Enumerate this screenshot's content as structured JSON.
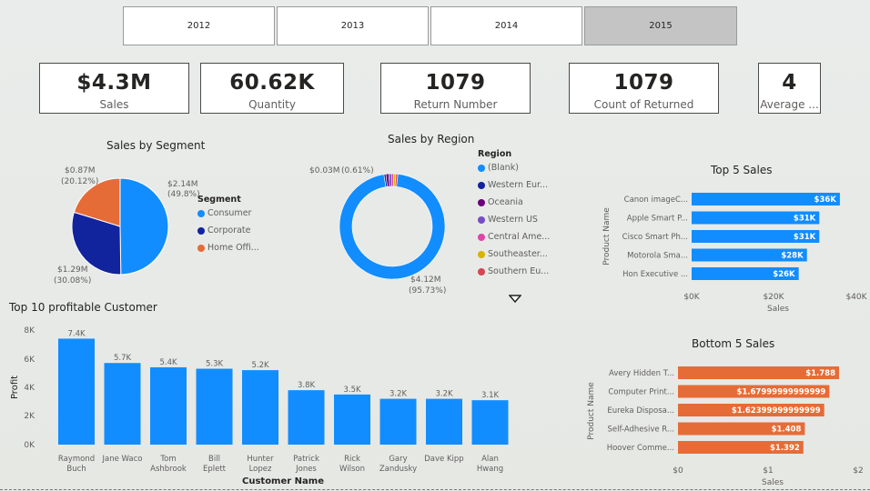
{
  "slicer": {
    "years": [
      "2012",
      "2013",
      "2014",
      "2015"
    ],
    "selected": "2015"
  },
  "cards": [
    {
      "value": "$4.3M",
      "label": "Sales"
    },
    {
      "value": "60.62K",
      "label": "Quantity"
    },
    {
      "value": "1079",
      "label": "Return Number"
    },
    {
      "value": "1079",
      "label": "Count of Returned"
    },
    {
      "value": "4",
      "label": "Average ..."
    }
  ],
  "segment": {
    "title": "Sales by Segment",
    "legend_title": "Segment",
    "legend": [
      {
        "label": "Consumer",
        "color": "#118dff"
      },
      {
        "label": "Corporate",
        "color": "#12239e"
      },
      {
        "label": "Home Offi...",
        "color": "#e66c37"
      }
    ],
    "labels": {
      "consumer_value": "$2.14M",
      "consumer_pct": "(49.8%)",
      "corporate_value": "$1.29M",
      "corporate_pct": "(30.08%)",
      "home_value": "$0.87M",
      "home_pct": "(20.12%)"
    }
  },
  "region": {
    "title": "Sales by Region",
    "legend_title": "Region",
    "legend": [
      {
        "label": "(Blank)",
        "color": "#118dff"
      },
      {
        "label": "Western Eur...",
        "color": "#12239e"
      },
      {
        "label": "Oceania",
        "color": "#6b007b"
      },
      {
        "label": "Western US",
        "color": "#744ec2"
      },
      {
        "label": "Central Ame...",
        "color": "#e044a7"
      },
      {
        "label": "Southeaster...",
        "color": "#d9b300"
      },
      {
        "label": "Southern Eu...",
        "color": "#d64550"
      }
    ],
    "labels": {
      "small_value": "$0.03M",
      "small_pct": "(0.61%)",
      "big_value": "$4.12M",
      "big_pct": "(95.73%)"
    }
  },
  "top5": {
    "title": "Top 5 Sales",
    "ylabel": "Product Name",
    "xlabel": "Sales",
    "ticks": [
      "$0K",
      "$20K",
      "$40K"
    ]
  },
  "bottom5": {
    "title": "Bottom 5 Sales",
    "ylabel": "Product Name",
    "xlabel": "Sales",
    "ticks": [
      "$0",
      "$1",
      "$2"
    ]
  },
  "customers": {
    "title": "Top 10 profitable Customer",
    "ylabel": "Profit",
    "xlabel": "Customer Name",
    "yticks": [
      "0K",
      "2K",
      "4K",
      "6K",
      "8K"
    ]
  },
  "chart_data": [
    {
      "type": "pie",
      "title": "Sales by Segment",
      "categories": [
        "Consumer",
        "Corporate",
        "Home Offi..."
      ],
      "values": [
        2.14,
        1.29,
        0.87
      ],
      "value_labels": [
        "$2.14M",
        "$1.29M",
        "$0.87M"
      ],
      "percent_labels": [
        "(49.8%)",
        "(30.08%)",
        "(20.12%)"
      ],
      "colors": [
        "#118dff",
        "#12239e",
        "#e66c37"
      ],
      "legend": "right"
    },
    {
      "type": "pie",
      "donut": true,
      "title": "Sales by Region",
      "categories": [
        "(Blank)",
        "Western Eur...",
        "Oceania",
        "Western US",
        "Central Ame...",
        "Southeaster...",
        "Southern Eu..."
      ],
      "values": [
        95.73,
        0.61,
        0.9,
        0.8,
        0.7,
        0.65,
        0.61
      ],
      "colors": [
        "#118dff",
        "#12239e",
        "#6b007b",
        "#744ec2",
        "#e044a7",
        "#d9b300",
        "#d64550"
      ],
      "legend": "right"
    },
    {
      "type": "bar",
      "orientation": "horizontal",
      "title": "Top 5 Sales",
      "categories": [
        "Canon imageC...",
        "Apple Smart P...",
        "Cisco Smart Ph...",
        "Motorola Sma...",
        "Hon Executive ..."
      ],
      "values": [
        36,
        31,
        31,
        28,
        26
      ],
      "value_labels": [
        "$36K",
        "$31K",
        "$31K",
        "$28K",
        "$26K"
      ],
      "xlim": [
        0,
        40
      ],
      "xlabel": "Sales",
      "ylabel": "Product Name",
      "color": "#118dff"
    },
    {
      "type": "bar",
      "orientation": "horizontal",
      "title": "Bottom 5 Sales",
      "categories": [
        "Avery Hidden T...",
        "Computer Print...",
        "Eureka Disposa...",
        "Self-Adhesive R...",
        "Hoover Comme..."
      ],
      "values": [
        1.788,
        1.68,
        1.623,
        1.408,
        1.392
      ],
      "value_labels": [
        "$1.788",
        "$1.67999999999999",
        "$1.62399999999999",
        "$1.408",
        "$1.392"
      ],
      "xlim": [
        0,
        2
      ],
      "xlabel": "Sales",
      "ylabel": "Product Name",
      "color": "#e66c37"
    },
    {
      "type": "bar",
      "title": "Top 10 profitable Customer",
      "categories": [
        "Raymond Buch",
        "Jane Waco",
        "Tom Ashbrook",
        "Bill Eplett",
        "Hunter Lopez",
        "Patrick Jones",
        "Rick Wilson",
        "Gary Zandusky",
        "Dave Kipp",
        "Alan Hwang"
      ],
      "values": [
        7.4,
        5.7,
        5.4,
        5.3,
        5.2,
        3.8,
        3.5,
        3.2,
        3.2,
        3.1
      ],
      "value_labels": [
        "7.4K",
        "5.7K",
        "5.4K",
        "5.3K",
        "5.2K",
        "3.8K",
        "3.5K",
        "3.2K",
        "3.2K",
        "3.1K"
      ],
      "ylim": [
        0,
        8
      ],
      "ylabel": "Profit",
      "xlabel": "Customer Name",
      "color": "#118dff"
    }
  ]
}
